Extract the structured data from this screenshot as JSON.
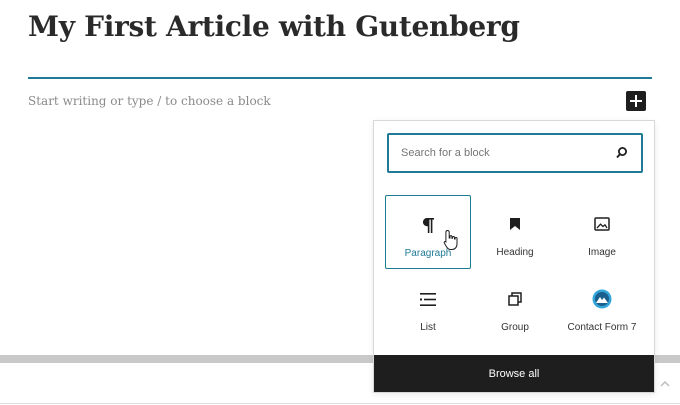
{
  "post": {
    "title": "My First Article with Gutenberg",
    "placeholder": "Start writing or type / to choose a block"
  },
  "inserter": {
    "search_placeholder": "Search for a block",
    "blocks": [
      {
        "label": "Paragraph",
        "icon": "paragraph-icon",
        "selected": true
      },
      {
        "label": "Heading",
        "icon": "bookmark-icon",
        "selected": false
      },
      {
        "label": "Image",
        "icon": "image-icon",
        "selected": false
      },
      {
        "label": "List",
        "icon": "list-icon",
        "selected": false
      },
      {
        "label": "Group",
        "icon": "group-icon",
        "selected": false
      },
      {
        "label": "Contact Form 7",
        "icon": "contact-form-icon",
        "selected": false
      }
    ],
    "browse_all_label": "Browse all"
  },
  "colors": {
    "accent": "#1f7a96",
    "dark": "#1e1e1e"
  }
}
